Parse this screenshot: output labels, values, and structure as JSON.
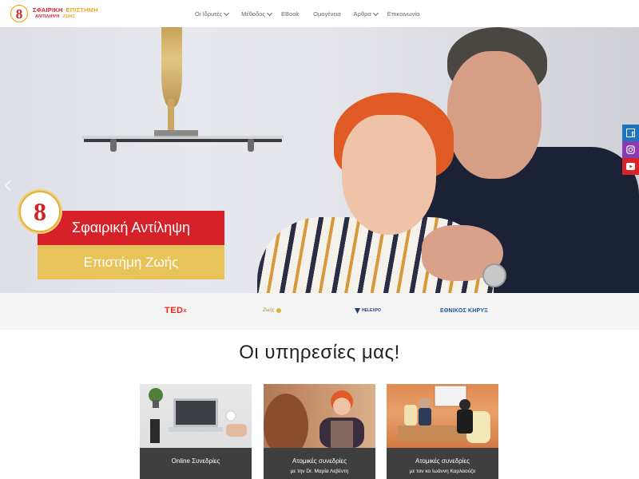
{
  "header": {
    "logo": {
      "line1_left": "ΣΦΑΙΡΙΚΗ",
      "line1_right": "ΕΠΙΣΤΗΜΗ",
      "line2_left": "ΑΝΤΙΛΗΨΗ",
      "line2_right": "ΖΩΗΣ"
    },
    "nav": [
      {
        "label": "Οι Ιδρυτές",
        "dropdown": true
      },
      {
        "label": "Μέθοδος",
        "dropdown": true
      },
      {
        "label": "EBook",
        "dropdown": false
      },
      {
        "label": "Ομογένεια",
        "dropdown": false
      },
      {
        "label": "Άρθρα",
        "dropdown": true
      },
      {
        "label": "Επικοινωνία",
        "dropdown": false
      }
    ]
  },
  "hero": {
    "banner_line1": "Σφαιρική Αντίληψη",
    "banner_line2": "Επιστήμη Ζωής",
    "colors": {
      "red": "#d62129",
      "yellow": "#e8c35a"
    }
  },
  "social": [
    {
      "name": "facebook-icon",
      "color": "#1e73be"
    },
    {
      "name": "instagram-icon",
      "color": "#8b3ab1"
    },
    {
      "name": "youtube-icon",
      "color": "#d9232a"
    }
  ],
  "partners": {
    "ted": "TED",
    "ted_suffix": "x",
    "zois": "Ζωής",
    "helexpo": "HELEXPO",
    "kiryx": "ΕΘΝΙΚΟΣ ΚΗΡΥΞ"
  },
  "services": {
    "title": "Οι υπηρεσίες μας!",
    "cards": [
      {
        "line1": "Online Συνεδρίες",
        "line2": ""
      },
      {
        "line1": "Ατομικές συνεδρίες",
        "line2": "με την Dr. Μαρία Λεβέντη"
      },
      {
        "line1": "Ατομικές συνεδρίες",
        "line2": "με τον κο Ιωάννη Καρλαούζο"
      }
    ]
  }
}
